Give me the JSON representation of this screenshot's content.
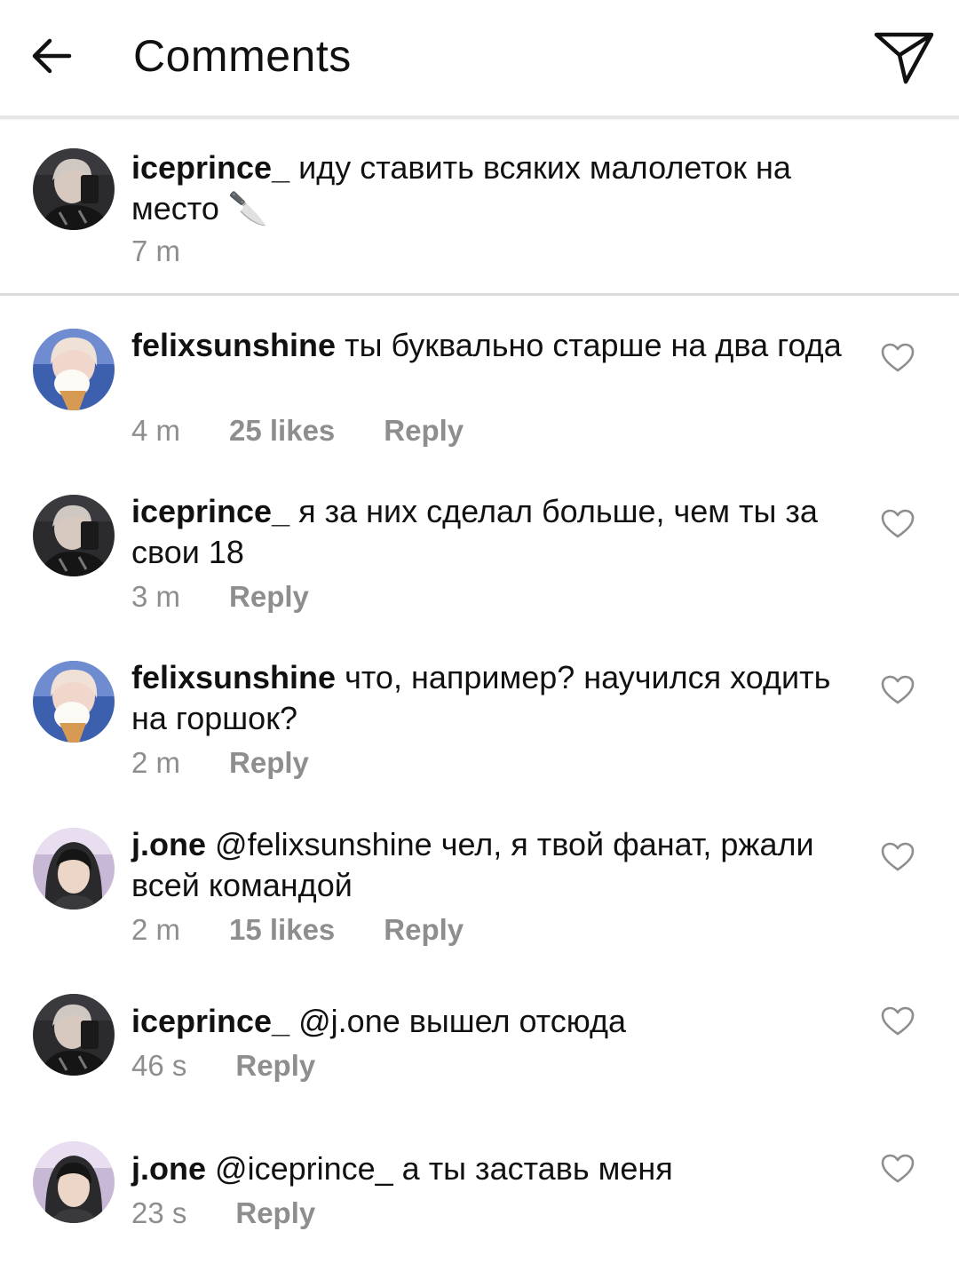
{
  "header": {
    "title": "Comments",
    "back_icon": "arrow-left-icon",
    "send_icon": "paper-plane-icon"
  },
  "caption": {
    "username": "iceprince_",
    "text": "иду ставить всяких малолеток на место 🔪",
    "time": "7 m"
  },
  "comments": [
    {
      "username": "felixsunshine",
      "text": "ты буквально старше на два года",
      "time": "4 m",
      "likes": "25 likes",
      "reply": "Reply"
    },
    {
      "username": "iceprince_",
      "text": "я за них сделал больше, чем ты за свои 18",
      "time": "3 m",
      "likes": "",
      "reply": "Reply"
    },
    {
      "username": "felixsunshine",
      "text": "что, например? научился ходить на горшок?",
      "time": "2 m",
      "likes": "",
      "reply": "Reply"
    },
    {
      "username": "j.one",
      "text": "@felixsunshine чел, я твой фанат, ржали всей командой",
      "time": "2 m",
      "likes": "15 likes",
      "reply": "Reply"
    },
    {
      "username": "iceprince_",
      "text": "@j.one вышел отсюда",
      "time": "46 s",
      "likes": "",
      "reply": "Reply"
    },
    {
      "username": "j.one",
      "text": "@iceprince_ а ты заставь меня",
      "time": "23 s",
      "likes": "",
      "reply": "Reply"
    }
  ],
  "colors": {
    "text": "#111111",
    "meta": "#8e8e8e",
    "divider": "#dcdcdc"
  }
}
